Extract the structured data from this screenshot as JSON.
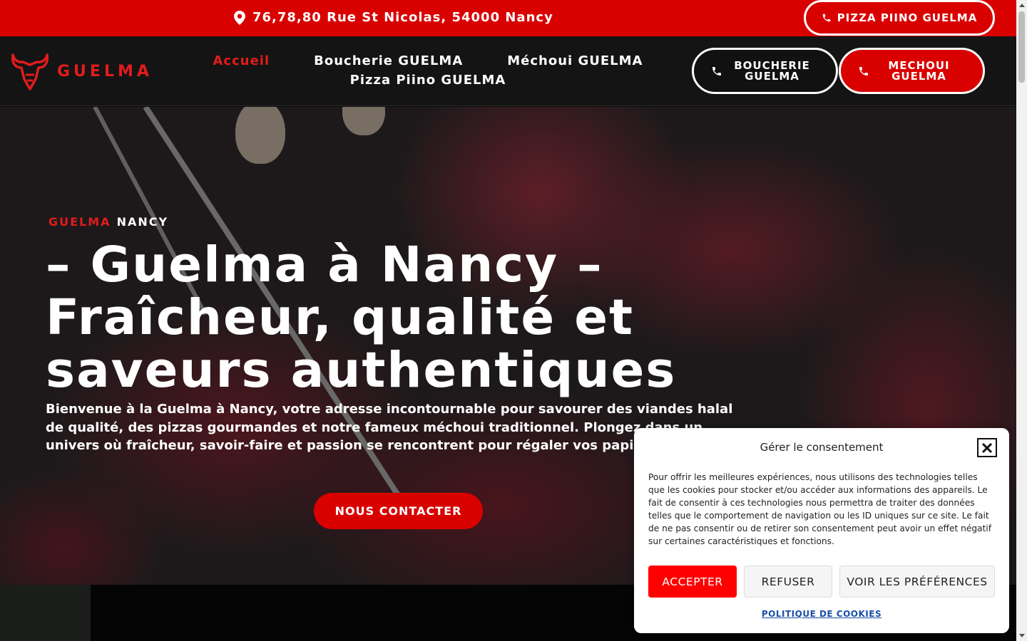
{
  "topbar": {
    "address": "76,78,80 Rue St Nicolas, 54000 Nancy",
    "pizza_button": "PIZZA PIINO GUELMA"
  },
  "header": {
    "logo_text": "GUELMA",
    "nav": [
      {
        "label": "Accueil",
        "active": true
      },
      {
        "label": "Boucherie GUELMA",
        "active": false
      },
      {
        "label": "Méchoui GUELMA",
        "active": false
      },
      {
        "label": "Pizza Piino GUELMA",
        "active": false
      }
    ],
    "boucherie_button": "BOUCHERIE GUELMA",
    "mechoui_button": "MECHOUI GUELMA"
  },
  "hero": {
    "kicker_red": "GUELMA",
    "kicker_white": "NANCY",
    "title": "– Guelma à Nancy – Fraîcheur, qualité et saveurs authentiques",
    "description": "Bienvenue à la Guelma à Nancy, votre adresse incontournable pour savourer des viandes halal de qualité, des pizzas gourmandes et notre fameux méchoui traditionnel. Plongez dans un univers où fraîcheur, savoir-faire et passion se rencontrent pour régaler vos papilles !",
    "cta": "NOUS CONTACTER"
  },
  "cookie_banner": {
    "title": "Gérer le consentement",
    "body": "Pour offrir les meilleures expériences, nous utilisons des technologies telles que les cookies pour stocker et/ou accéder aux informations des appareils. Le fait de consentir à ces technologies nous permettra de traiter des données telles que le comportement de navigation ou les ID uniques sur ce site. Le fait de ne pas consentir ou de retirer son consentement peut avoir un effet négatif sur certaines caractéristiques et fonctions.",
    "accept": "ACCEPTER",
    "refuse": "REFUSER",
    "preferences": "VOIR LES PRÉFÉRENCES",
    "policy_link": "POLITIQUE DE COOKIES"
  },
  "colors": {
    "brand_red": "#d90000",
    "accent_red": "#e21c1c",
    "header_bg": "#141414",
    "link_blue": "#1a4ea8"
  }
}
